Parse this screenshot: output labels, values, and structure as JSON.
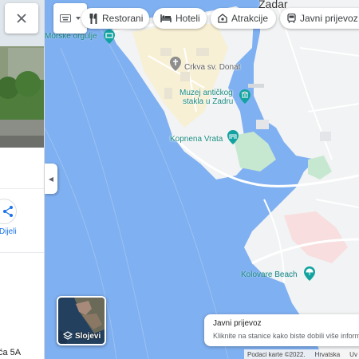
{
  "side_panel": {
    "close_icon": "close-icon",
    "share_label": "Dijeli",
    "share_icon": "share-icon",
    "address_fragment": "ća 5A"
  },
  "toolbar": {
    "input_tools_icon": "keyboard-icon",
    "chips": [
      {
        "label": "Restorani",
        "icon": "restaurant-icon"
      },
      {
        "label": "Hoteli",
        "icon": "hotel-icon"
      },
      {
        "label": "Atrakcije",
        "icon": "attraction-icon"
      },
      {
        "label": "Javni prijevoz",
        "icon": "transit-icon"
      }
    ]
  },
  "map": {
    "city_label": "Zadar",
    "places": [
      {
        "name": "Morske orgulje",
        "kind": "attraction"
      },
      {
        "name": "Crkva sv. Donat",
        "kind": "church"
      },
      {
        "name": "Muzej antičkog stakla u Zadru",
        "line1": "Muzej antičkog",
        "line2": "stakla u Zadru",
        "kind": "museum"
      },
      {
        "name": "Kopnena Vrata",
        "kind": "landmark"
      },
      {
        "name": "Kolovare Beach",
        "kind": "beach"
      }
    ],
    "colors": {
      "water": "#7fb0f1",
      "land": "#f1f3f4",
      "park": "#c7e8d0",
      "old_town": "#f8f0d4",
      "hospital": "#f8dede"
    }
  },
  "layers": {
    "label": "Slojevi",
    "icon": "layers-icon"
  },
  "transit_card": {
    "title": "Javni prijevoz",
    "description": "Kliknite na stanice kako biste dobili više informa"
  },
  "footer": {
    "attribution": "Podaci karte ©2022.",
    "country": "Hrvatska",
    "terms": "Uv"
  }
}
